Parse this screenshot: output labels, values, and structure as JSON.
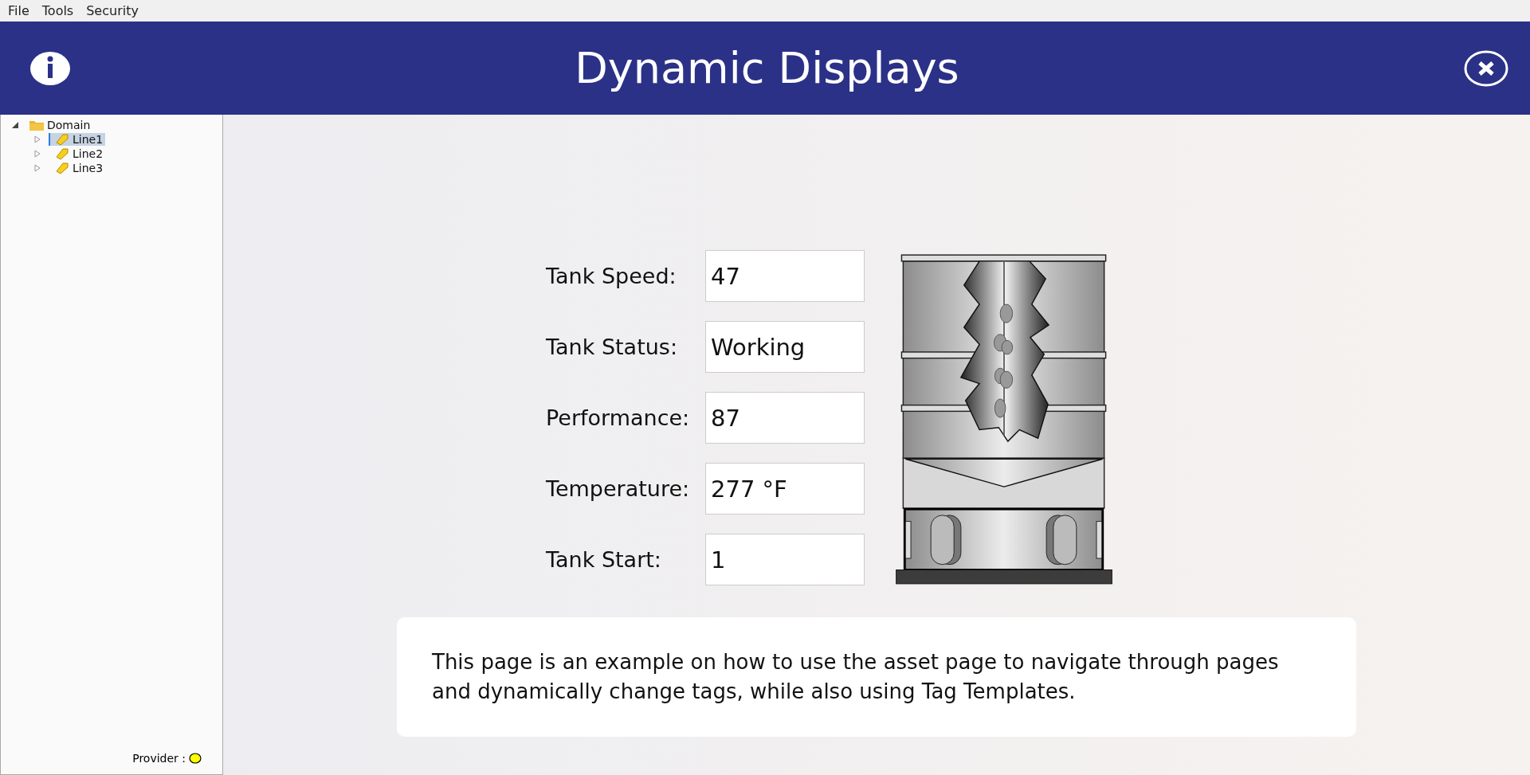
{
  "menu": [
    "File",
    "Tools",
    "Security"
  ],
  "header": {
    "title": "Dynamic Displays"
  },
  "tree": [
    {
      "label": "Domain",
      "kind": "folder",
      "expanded": true,
      "selected": false,
      "children": [
        {
          "label": "Line1",
          "kind": "tag",
          "expanded": false,
          "selected": true
        },
        {
          "label": "Line2",
          "kind": "tag",
          "expanded": false,
          "selected": false
        },
        {
          "label": "Line3",
          "kind": "tag",
          "expanded": false,
          "selected": false
        }
      ]
    }
  ],
  "provider": {
    "label": "Provider :",
    "color": "#ffff00"
  },
  "fields": [
    {
      "label": "Tank Speed:",
      "value": "47"
    },
    {
      "label": "Tank Status:",
      "value": "Working"
    },
    {
      "label": "Performance:",
      "value": "87"
    },
    {
      "label": "Temperature:",
      "value": "277 °F"
    },
    {
      "label": "Tank Start:",
      "value": "1"
    }
  ],
  "description": "This page is an example on how to use the asset page to navigate through pages and dynamically change tags, while also using Tag Templates."
}
